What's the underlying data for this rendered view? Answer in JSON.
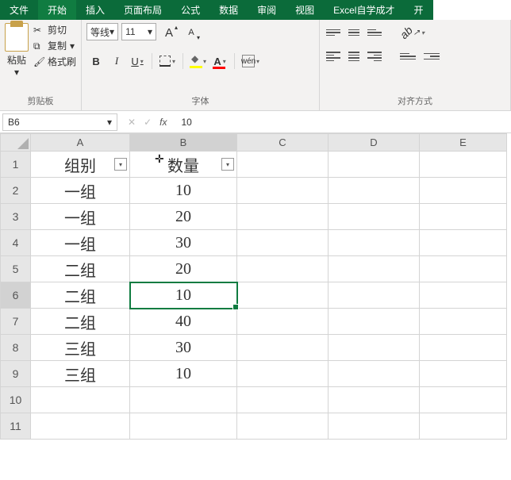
{
  "tabs": {
    "file": "文件",
    "home": "开始",
    "insert": "插入",
    "layout": "页面布局",
    "formula": "公式",
    "data": "数据",
    "review": "审阅",
    "view": "视图",
    "custom": "Excel自学成才",
    "more": "开"
  },
  "ribbon": {
    "clipboard": {
      "paste": "粘贴",
      "cut": "剪切",
      "copy": "复制",
      "format_painter": "格式刷",
      "label": "剪贴板"
    },
    "font": {
      "name": "等线",
      "size": "11",
      "increase_glyph": "A",
      "decrease_glyph": "A",
      "bold": "B",
      "italic": "I",
      "underline": "U",
      "fontcolor_glyph": "A",
      "wen": "wén",
      "label": "字体"
    },
    "align": {
      "orient_glyph": "ab",
      "label": "对齐方式"
    }
  },
  "namebox": "B6",
  "fx_value": "10",
  "columns": [
    "A",
    "B",
    "C",
    "D",
    "E"
  ],
  "rows": [
    "1",
    "2",
    "3",
    "4",
    "5",
    "6",
    "7",
    "8",
    "9",
    "10",
    "11"
  ],
  "headers": {
    "A": "组别",
    "B": "数量"
  },
  "cells": {
    "r2": {
      "A": "一组",
      "B": "10"
    },
    "r3": {
      "A": "一组",
      "B": "20"
    },
    "r4": {
      "A": "一组",
      "B": "30"
    },
    "r5": {
      "A": "二组",
      "B": "20"
    },
    "r6": {
      "A": "二组",
      "B": "10"
    },
    "r7": {
      "A": "二组",
      "B": "40"
    },
    "r8": {
      "A": "三组",
      "B": "30"
    },
    "r9": {
      "A": "三组",
      "B": "10"
    }
  },
  "chart_data": {
    "type": "table",
    "title": "",
    "columns": [
      "组别",
      "数量"
    ],
    "rows": [
      [
        "一组",
        10
      ],
      [
        "一组",
        20
      ],
      [
        "一组",
        30
      ],
      [
        "二组",
        20
      ],
      [
        "二组",
        10
      ],
      [
        "二组",
        40
      ],
      [
        "三组",
        30
      ],
      [
        "三组",
        10
      ]
    ]
  }
}
